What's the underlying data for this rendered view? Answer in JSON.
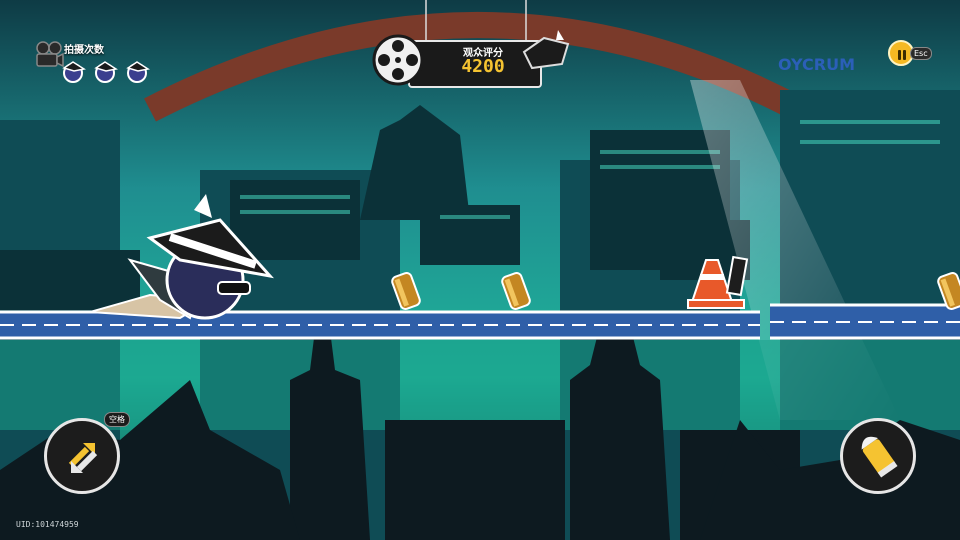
{
  "hud": {
    "shots_label": "拍摄次数",
    "shots_remaining": 3,
    "shots_icon": "film-camera-icon",
    "score_label": "观众评分",
    "score_value": "4200",
    "score_icon": "film-reel-icon",
    "pause_icon": "pause-icon",
    "pause_key": "Esc"
  },
  "controls": {
    "switch_key": "空格",
    "switch_icon": "swap-arrows-icon",
    "fire_icon": "bullet-icon"
  },
  "scene": {
    "sign_text": "OYCRUM",
    "items": [
      "bullet",
      "bullet",
      "traffic-cone",
      "bullet"
    ]
  },
  "footer": {
    "uid": "UID:101474959"
  },
  "colors": {
    "sky": "#1f8e90",
    "accent_gold": "#f5c331",
    "rail": "#2f5fa8",
    "silhouette": "#0d1a20"
  }
}
